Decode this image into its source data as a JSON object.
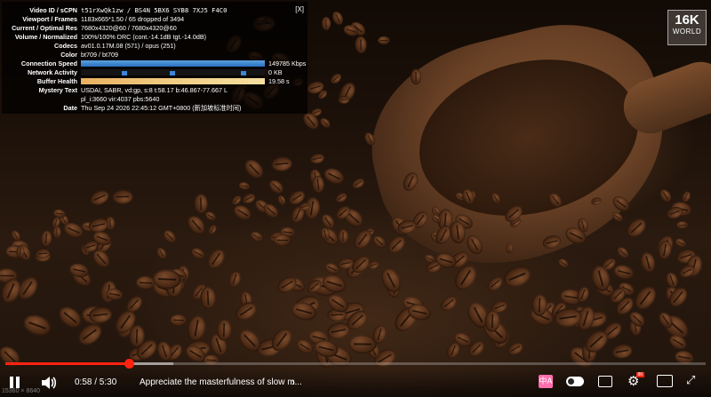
{
  "stats": {
    "close_label": "[X]",
    "rows": [
      {
        "label": "Video ID / sCPN",
        "value": "t51rXwQk1zw / BS4N 5BX6 SYB8 7XJ5 F4C0"
      },
      {
        "label": "Viewport / Frames",
        "value": "1183x665*1.50 / 65 dropped of 3494"
      },
      {
        "label": "Current / Optimal Res",
        "value": "7680x4320@60 / 7680x4320@60"
      },
      {
        "label": "Volume / Normalized",
        "value": "100%/100% DRC (cont.-14.1dB tgt.-14.0dB)"
      },
      {
        "label": "Codecs",
        "value": "av01.0.17M.08 (571) / opus (251)"
      },
      {
        "label": "Color",
        "value": "bt709 / bt709"
      },
      {
        "label": "Connection Speed",
        "value": "149785 Kbps"
      },
      {
        "label": "Network Activity",
        "value": "0 KB"
      },
      {
        "label": "Buffer Health",
        "value": "19.58 s"
      },
      {
        "label": "Mystery Text",
        "value": "USDAI, SABR, vd:gp, s:8 t:58.17 b:46.867-77.667 L",
        "value2": "pl_i:3660 vir:4037 pbs:5640"
      },
      {
        "label": "Date",
        "value": "Thu Sep 24 2026 22:45:12 GMT+0800 (新加坡标准时间)"
      }
    ],
    "connection_speed_fraction": 1.0,
    "buffer_health_fraction": 1.0
  },
  "badge": {
    "big": "16K",
    "small": "WORLD"
  },
  "resolution_overlay": "15360 × 8640",
  "player": {
    "time_display": "0:58 / 5:30",
    "played_fraction": 0.1758,
    "buffered_fraction": 0.24,
    "video_title": "Appreciate the masterfulness of slow m...",
    "chevron": "›",
    "cc_label": "中A",
    "hd_label": "8K"
  },
  "colors": {
    "accent": "#ff2211",
    "overlay_bg": "#000000",
    "speed_bar": "#3c86d8",
    "buffer_bar": "#f2d28a"
  }
}
